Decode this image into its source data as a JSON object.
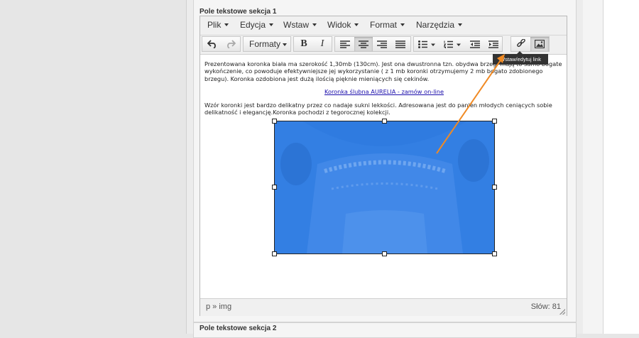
{
  "section1": {
    "title": "Pole tekstowe sekcja 1"
  },
  "section2": {
    "title": "Pole tekstowe sekcja 2"
  },
  "menubar": {
    "items": [
      {
        "label": "Plik"
      },
      {
        "label": "Edycja"
      },
      {
        "label": "Wstaw"
      },
      {
        "label": "Widok"
      },
      {
        "label": "Format"
      },
      {
        "label": "Narzędzia"
      }
    ]
  },
  "toolbar": {
    "formats_label": "Formaty",
    "buttons": [
      {
        "name": "undo",
        "icon": "undo-icon"
      },
      {
        "name": "redo",
        "icon": "redo-icon",
        "state": "disabled"
      },
      {
        "name": "bold",
        "icon": "bold-icon"
      },
      {
        "name": "italic",
        "icon": "italic-icon"
      },
      {
        "name": "align-left",
        "icon": "align-left-icon"
      },
      {
        "name": "align-center",
        "icon": "align-center-icon",
        "state": "active"
      },
      {
        "name": "align-right",
        "icon": "align-right-icon"
      },
      {
        "name": "justify",
        "icon": "justify-icon"
      },
      {
        "name": "bullet-list",
        "icon": "bullet-list-icon"
      },
      {
        "name": "numbered-list",
        "icon": "numbered-list-icon"
      },
      {
        "name": "outdent",
        "icon": "outdent-icon"
      },
      {
        "name": "indent",
        "icon": "indent-icon"
      },
      {
        "name": "link",
        "icon": "link-icon"
      },
      {
        "name": "image",
        "icon": "image-icon",
        "state": "active"
      }
    ]
  },
  "tooltip": {
    "text": "Wstaw/edytuj link"
  },
  "content": {
    "para1": "Prezentowana koronka biała ma szerokość 1,30mb (130cm). Jest ona dwustronna tzn. obydwa brzegi mają to samo bogate wykończenie, co powoduje efektywniejsze jej wykorzystanie ( z 1 mb koronki otrzymujemy 2 mb bogato zdobionego brzegu). Koronka ozdobiona jest dużą ilością pięknie mieniących się cekinów.",
    "link_text": "Koronka ślubna AURELIA - zamów on-line",
    "para2": "Wzór koronki jest bardzo delikatny przez co nadaje sukni lekkości. Adresowana jest do panien młodych ceniących sobie delikatność i elegancję.Koronka pochodzi z tegorocznej kolekcji."
  },
  "image": {
    "overlay_color": "#2f7be0"
  },
  "statusbar": {
    "path": "p » img",
    "wordcount": "Słów: 81"
  },
  "colors": {
    "arrow": "#f08a24",
    "tooltip_bg": "#333333"
  }
}
